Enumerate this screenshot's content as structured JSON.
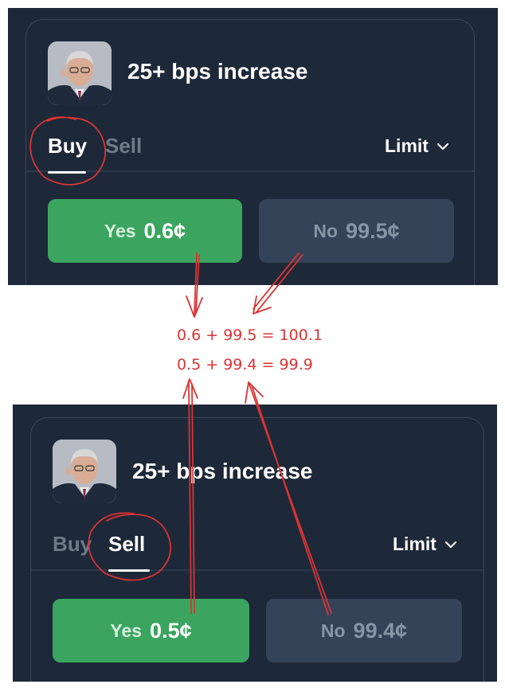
{
  "top_panel": {
    "market_title": "25+ bps increase",
    "tabs": {
      "buy": "Buy",
      "sell": "Sell",
      "active": "buy"
    },
    "order_type": "Limit",
    "yes_button": {
      "label": "Yes",
      "price": "0.6¢"
    },
    "no_button": {
      "label": "No",
      "price": "99.5¢"
    }
  },
  "bottom_panel": {
    "market_title": "25+ bps increase",
    "tabs": {
      "buy": "Buy",
      "sell": "Sell",
      "active": "sell"
    },
    "order_type": "Limit",
    "yes_button": {
      "label": "Yes",
      "price": "0.5¢"
    },
    "no_button": {
      "label": "No",
      "price": "99.4¢"
    }
  },
  "annotation": {
    "line_1": "0.6 + 99.5 = 100.1",
    "line_2": "0.5 + 99.4 = 99.9",
    "color": "#d93434"
  },
  "colors": {
    "panel_bg": "#1d2838",
    "yes_green": "#3ba560",
    "no_slate": "#344358"
  },
  "icons": {
    "chevron": "chevron-down-icon",
    "avatar": "market-avatar-photo"
  }
}
